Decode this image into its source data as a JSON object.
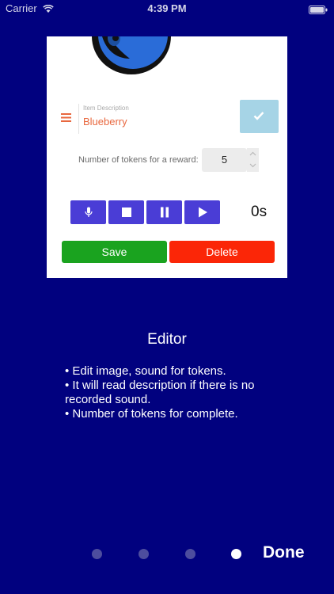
{
  "status_bar": {
    "carrier": "Carrier",
    "time": "4:39 PM"
  },
  "editor": {
    "item_description_label": "Item Description",
    "item_description_value": "Blueberry",
    "tokens_label": "Number of tokens for a reward:",
    "tokens_value": "5",
    "duration": "0s",
    "save_label": "Save",
    "delete_label": "Delete"
  },
  "info": {
    "title": "Editor",
    "lines": [
      "• Edit image, sound for tokens.",
      "• It will read description if there is no recorded sound.",
      "• Number of tokens for complete."
    ]
  },
  "pager": {
    "page_count": 4,
    "active_index": 3,
    "done_label": "Done"
  },
  "colors": {
    "background": "#01017f",
    "accent_label": "#e8683f",
    "media_button": "#4a3dd6",
    "save": "#1aa31f",
    "delete": "#fb2607",
    "confirm": "#a6d4e6"
  },
  "icons": [
    "wifi-icon",
    "battery-icon",
    "menu-icon",
    "checkmark-icon",
    "microphone-icon",
    "stop-icon",
    "pause-icon",
    "play-icon"
  ]
}
